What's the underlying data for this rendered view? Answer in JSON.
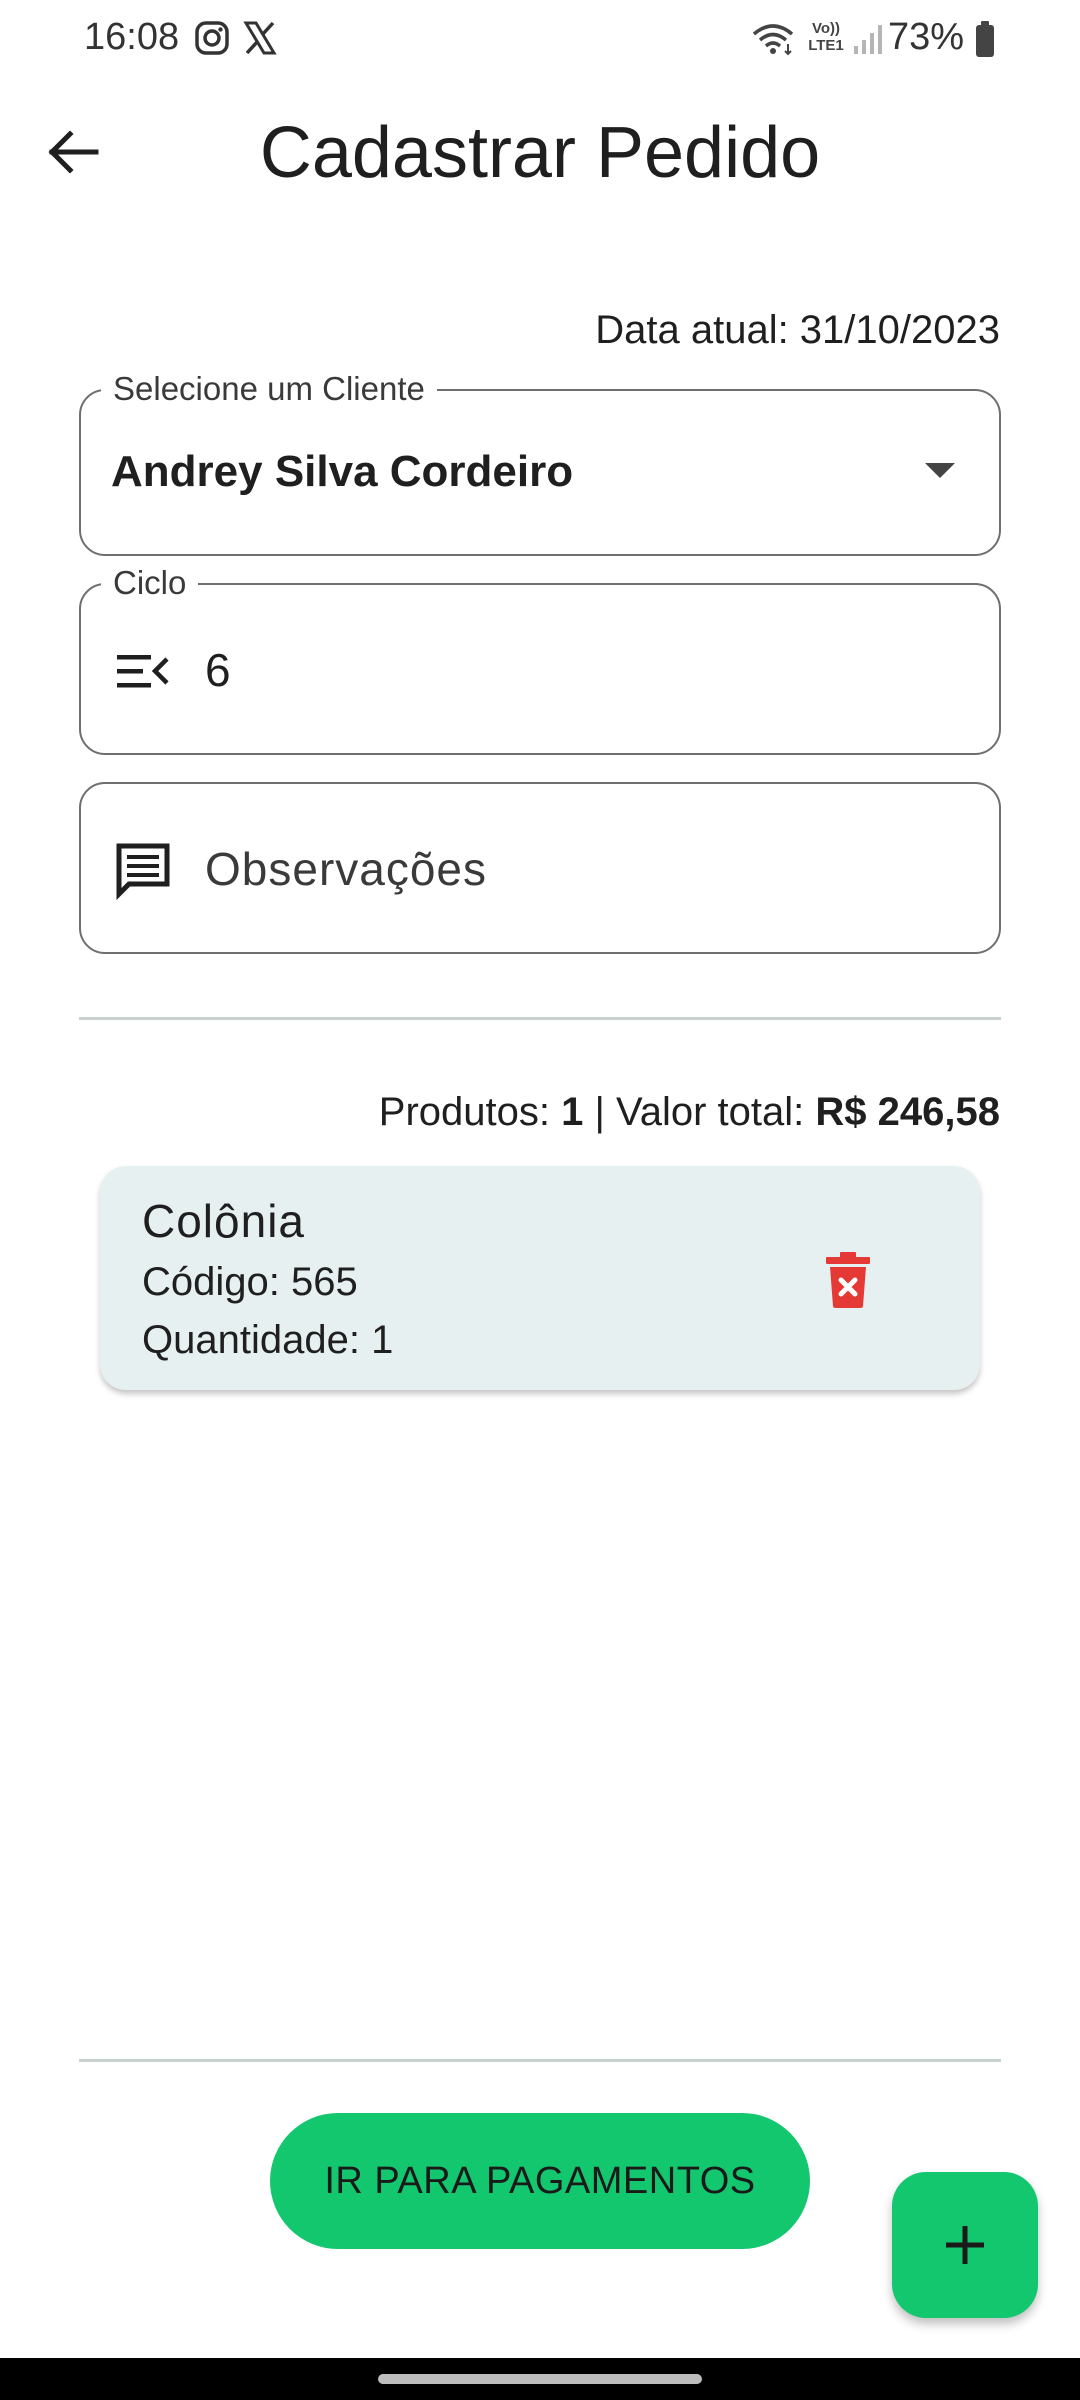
{
  "status_bar": {
    "time": "16:08",
    "battery": "73%",
    "left_icons": [
      "instagram-icon",
      "x-icon"
    ],
    "right_icons": [
      "wifi-icon",
      "volte-icon",
      "signal-icon",
      "battery-icon"
    ],
    "volte_label_top": "Vo))",
    "volte_label_bottom": "LTE1"
  },
  "header": {
    "title": "Cadastrar Pedido",
    "back_icon": "arrow-left-icon"
  },
  "form": {
    "date_label": "Data atual: 31/10/2023",
    "client": {
      "label": "Selecione um Cliente",
      "value": "Andrey Silva Cordeiro"
    },
    "cycle": {
      "label": "Ciclo",
      "value": "6",
      "icon": "menu-open-icon"
    },
    "observations": {
      "placeholder": "Observações",
      "icon": "comment-icon"
    }
  },
  "summary": {
    "products_label": "Produtos:",
    "products_count": "1",
    "separator": "|",
    "total_label": "Valor total:",
    "total_value": "R$ 246,58"
  },
  "products": [
    {
      "name": "Colônia",
      "code": "Código: 565",
      "quantity": "Quantidade: 1"
    }
  ],
  "actions": {
    "pay_button": "IR PARA PAGAMENTOS",
    "fab_icon": "plus-icon"
  },
  "colors": {
    "accent": "#13c76f",
    "card_bg": "#e7f0f1",
    "delete": "#e53935",
    "outline": "#6f6f6f"
  }
}
